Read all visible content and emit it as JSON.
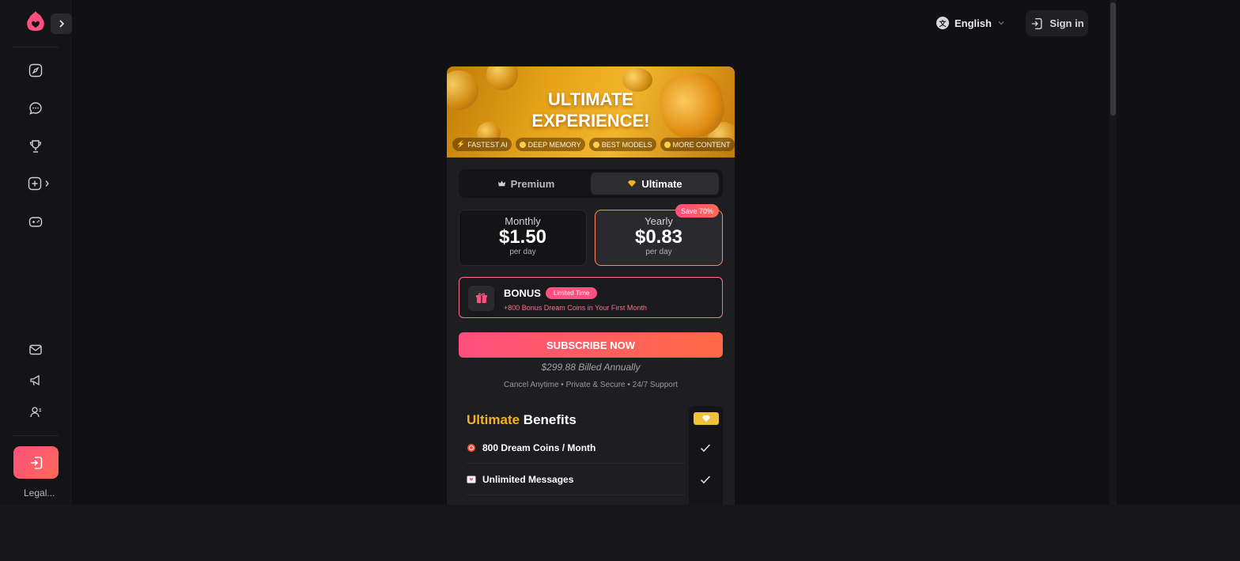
{
  "sidebar": {
    "legal_label": "Legal..."
  },
  "topbar": {
    "language": "English",
    "language_icon_glyph": "文",
    "signin_label": "Sign in"
  },
  "banner": {
    "title_line1": "ULTIMATE",
    "title_line2": "EXPERIENCE!",
    "tags": [
      "FASTEST AI",
      "DEEP MEMORY",
      "BEST MODELS",
      "MORE CONTENT"
    ]
  },
  "tabs": {
    "premium_label": "Premium",
    "ultimate_label": "Ultimate",
    "selected": "Ultimate"
  },
  "plans": {
    "monthly": {
      "name": "Monthly",
      "price": "$1.50",
      "unit": "per day"
    },
    "yearly": {
      "name": "Yearly",
      "price": "$0.83",
      "unit": "per day",
      "badge": "Save 70%"
    },
    "selected": "Yearly"
  },
  "bonus": {
    "title": "BONUS",
    "badge": "Limited Time",
    "description": "+800 Bonus Dream Coins in Your First Month"
  },
  "cta": {
    "subscribe_label": "SUBSCRIBE NOW",
    "billed_text": "$299.88 Billed Annually",
    "guarantees_text": "Cancel Anytime • Private & Secure • 24/7 Support"
  },
  "benefits": {
    "title_highlight": "Ultimate",
    "title_rest": " Benefits",
    "items": [
      {
        "label": "800 Dream Coins / Month",
        "icon": "coin-icon",
        "included": true
      },
      {
        "label": "Unlimited Messages",
        "icon": "message-heart-icon",
        "included": true
      }
    ]
  },
  "colors": {
    "accent_pink": "#ff4f7e",
    "accent_orange": "#ff6a55",
    "gold": "#f6b21b",
    "background": "#111113"
  }
}
